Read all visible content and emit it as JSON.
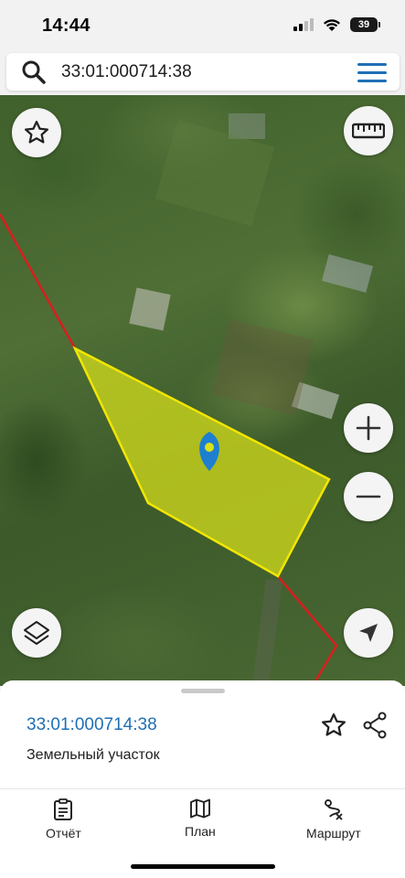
{
  "status_bar": {
    "time": "14:44",
    "battery": "39"
  },
  "search": {
    "value": "33:01:000714:38"
  },
  "map_controls": {
    "favorite_icon": "star-outline-icon",
    "ruler_icon": "ruler-icon",
    "zoom_in_icon": "plus-icon",
    "zoom_out_icon": "minus-icon",
    "layers_icon": "layers-icon",
    "location_icon": "navigation-arrow-icon"
  },
  "parcel_sheet": {
    "number": "33:01:000714:38",
    "type": "Земельный участок"
  },
  "bottom_nav": {
    "items": [
      {
        "label": "Отчёт",
        "icon": "clipboard-icon"
      },
      {
        "label": "План",
        "icon": "map-icon"
      },
      {
        "label": "Маршрут",
        "icon": "route-icon"
      }
    ]
  },
  "colors": {
    "accent": "#1f6fb5",
    "parcel_fill": "#d9e21a",
    "parcel_border": "#f2e600",
    "boundary_line": "#d81e1e",
    "pin": "#1e7fd0"
  }
}
